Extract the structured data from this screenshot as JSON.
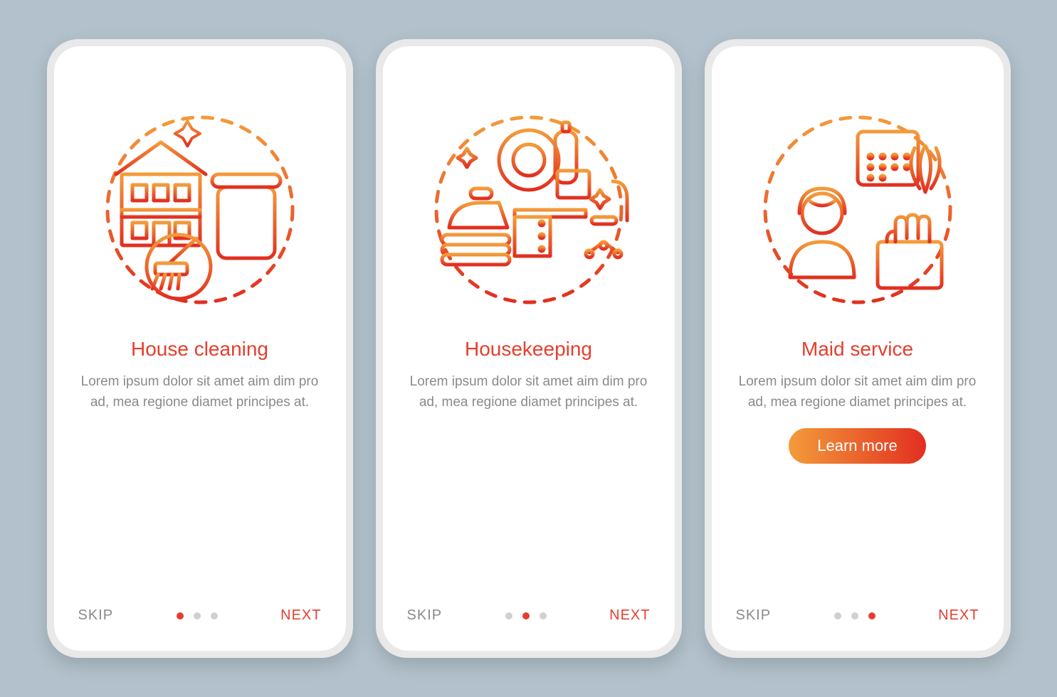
{
  "common": {
    "skip_label": "SKIP",
    "next_label": "NEXT",
    "body_text": "Lorem ipsum dolor sit amet aim dim pro ad, mea regione diamet principes at."
  },
  "screens": [
    {
      "title": "House cleaning",
      "icon": "house-cleaning-icon",
      "has_cta": false,
      "active_dot": 0
    },
    {
      "title": "Housekeeping",
      "icon": "housekeeping-icon",
      "has_cta": false,
      "active_dot": 1
    },
    {
      "title": "Maid service",
      "icon": "maid-service-icon",
      "has_cta": true,
      "active_dot": 2
    }
  ],
  "cta_label": "Learn more",
  "colors": {
    "accent": "#e53e2e",
    "gradient_start": "#f39b3a",
    "gradient_end": "#e22f20",
    "muted": "#8a8a8a"
  }
}
